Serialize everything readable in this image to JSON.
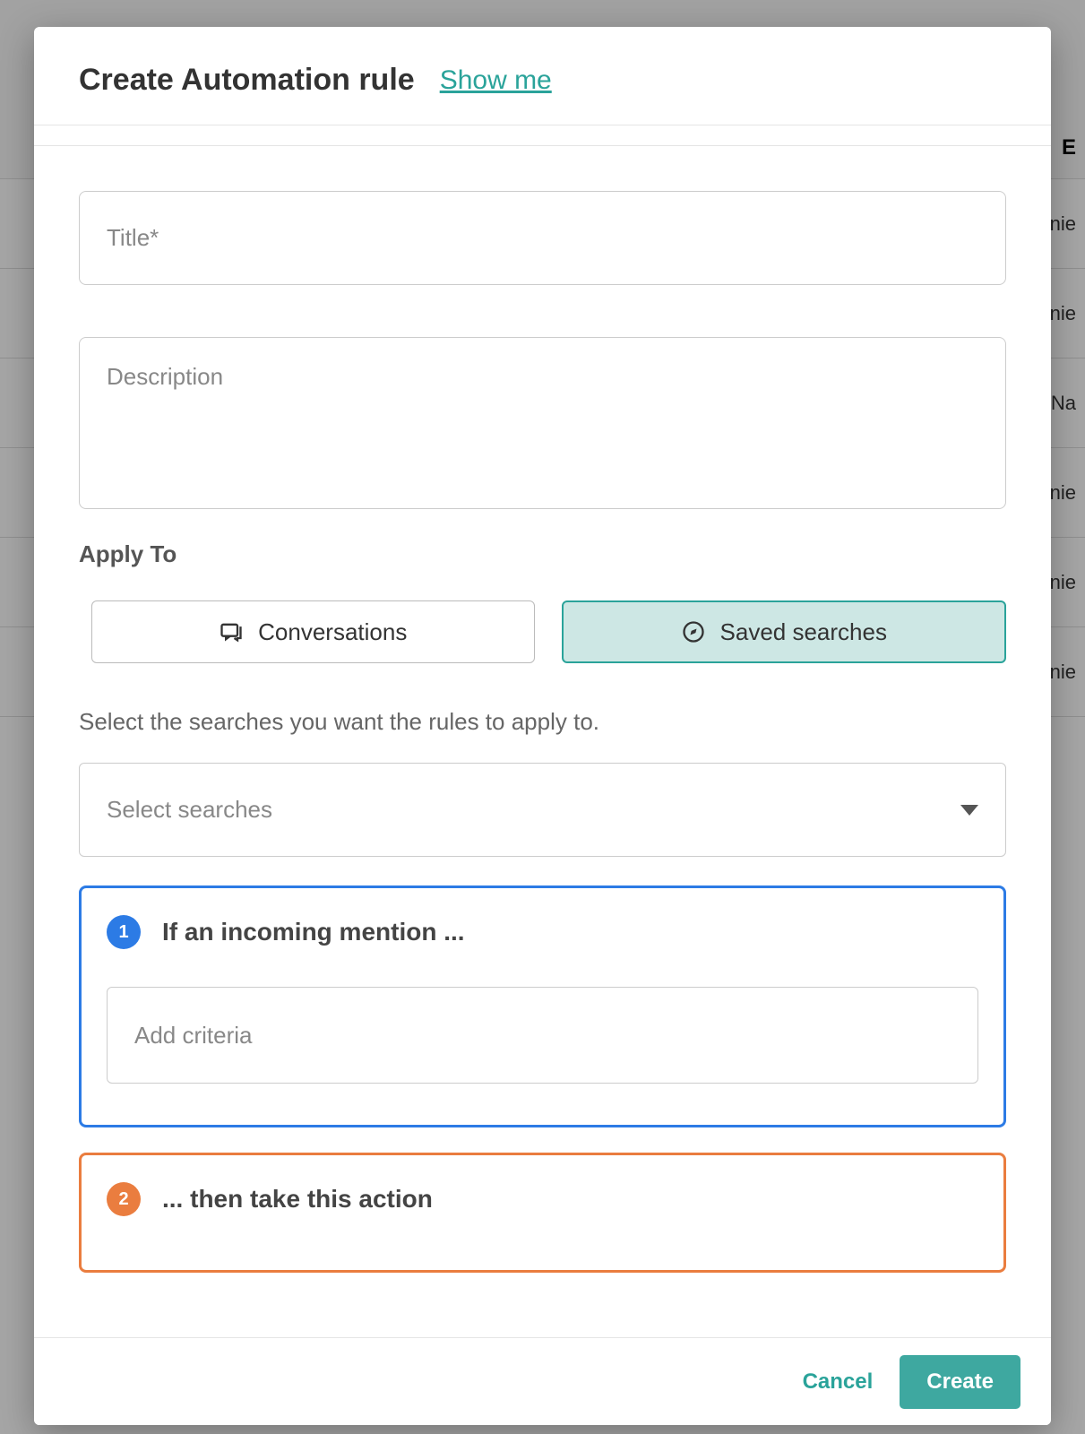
{
  "background": {
    "header": "E",
    "rows": [
      "nie",
      "nie",
      "Na",
      "nie",
      "nie",
      "nie"
    ]
  },
  "dialog": {
    "title": "Create Automation rule",
    "show_me": "Show me",
    "fields": {
      "title_placeholder": "Title*",
      "description_placeholder": "Description"
    },
    "apply_to": {
      "label": "Apply To",
      "options": {
        "conversations": "Conversations",
        "saved_searches": "Saved searches"
      },
      "selected": "saved_searches",
      "helper": "Select the searches you want the rules to apply to.",
      "select_placeholder": "Select searches"
    },
    "steps": {
      "s1": {
        "number": "1",
        "title": "If an incoming mention ...",
        "dropdown_placeholder": "Add criteria"
      },
      "s2": {
        "number": "2",
        "title": "... then take this action"
      }
    },
    "footer": {
      "cancel": "Cancel",
      "create": "Create"
    }
  }
}
